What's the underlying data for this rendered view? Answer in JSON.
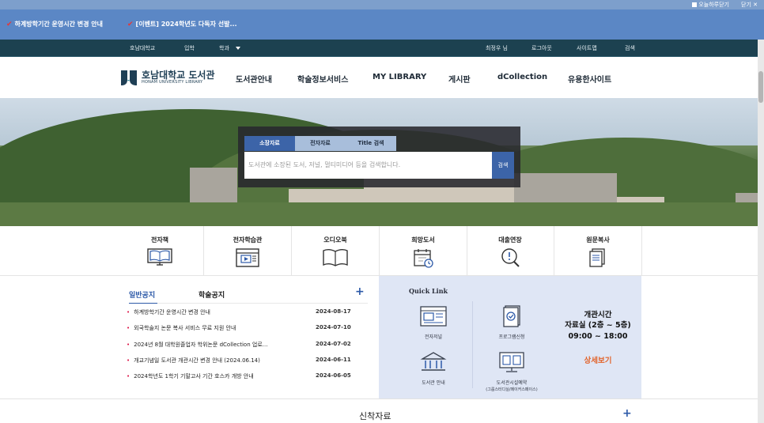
{
  "topbar": {
    "today_close": "오늘하루닫기",
    "close": "닫기"
  },
  "notices_top": [
    "하계방학기간 운영시간 변경 안내",
    "[이벤트] 2024학년도 다독자 선발..."
  ],
  "utility": {
    "left": [
      "호남대학교",
      "입학",
      "학과"
    ],
    "right": [
      "최정우 님",
      "로그아웃",
      "사이트맵",
      "검색"
    ]
  },
  "logo": {
    "korean": "호남대학교 도서관",
    "english": "HONAM UNIVERSITY LIBRARY",
    "color": "#1f3f55"
  },
  "gnb": [
    "도서관안내",
    "학술정보서비스",
    "MY LIBRARY",
    "게시판",
    "dCollection",
    "유용한사이트"
  ],
  "search": {
    "tabs": [
      "소장자료",
      "전자자료",
      "Title 검색"
    ],
    "active_tab": "소장자료",
    "placeholder": "도서관에 소장된 도서, 저널, 멀티미디어 등을 검색합니다.",
    "button": "검색",
    "accent": "#3c64a8"
  },
  "quick_menu": [
    {
      "label": "전자책",
      "icon": "ebook-icon"
    },
    {
      "label": "전자학습관",
      "icon": "elearning-icon"
    },
    {
      "label": "오디오북",
      "icon": "audiobook-icon"
    },
    {
      "label": "희망도서",
      "icon": "calendar-icon"
    },
    {
      "label": "대출연장",
      "icon": "magnifier-icon"
    },
    {
      "label": "원문복사",
      "icon": "copy-icon"
    }
  ],
  "board": {
    "tab_general": "일반공지",
    "tab_academic": "학술공지",
    "more": "+",
    "items": [
      {
        "title": "하계방학기간 운영시간 변경 안내",
        "date": "2024-08-17"
      },
      {
        "title": "외국학술지 논문 복사 서비스 무료 지원 안내",
        "date": "2024-07-10"
      },
      {
        "title": "2024년 8월 대학원졸업자 학위논문 dCollection 업로...",
        "date": "2024-07-02"
      },
      {
        "title": "개교기념일 도서관 개관시간 변경 안내 (2024.06.14)",
        "date": "2024-06-11"
      },
      {
        "title": "2024학년도 1학기 기말고사 기간 호스카 개방 안내",
        "date": "2024-06-05"
      }
    ]
  },
  "quick_link": {
    "title": "Quick Link",
    "items": [
      {
        "label": "전자저널",
        "icon": "ejournal-icon"
      },
      {
        "label": "프로그램신청",
        "icon": "program-icon"
      },
      {
        "label": "도서관 안내",
        "icon": "library-building-icon"
      },
      {
        "label": "도서관시설예약",
        "sub": "(그룹스터디실/메이커스페이스)",
        "icon": "monitor-icon"
      }
    ]
  },
  "hours": {
    "title": "개관시간",
    "room": "자료실 (2층 ~ 5층)",
    "time": "09:00 ~ 18:00",
    "more": "상세보기",
    "more_color": "#e2632a"
  },
  "new_arrivals": {
    "title": "신착자료",
    "more": "+"
  }
}
